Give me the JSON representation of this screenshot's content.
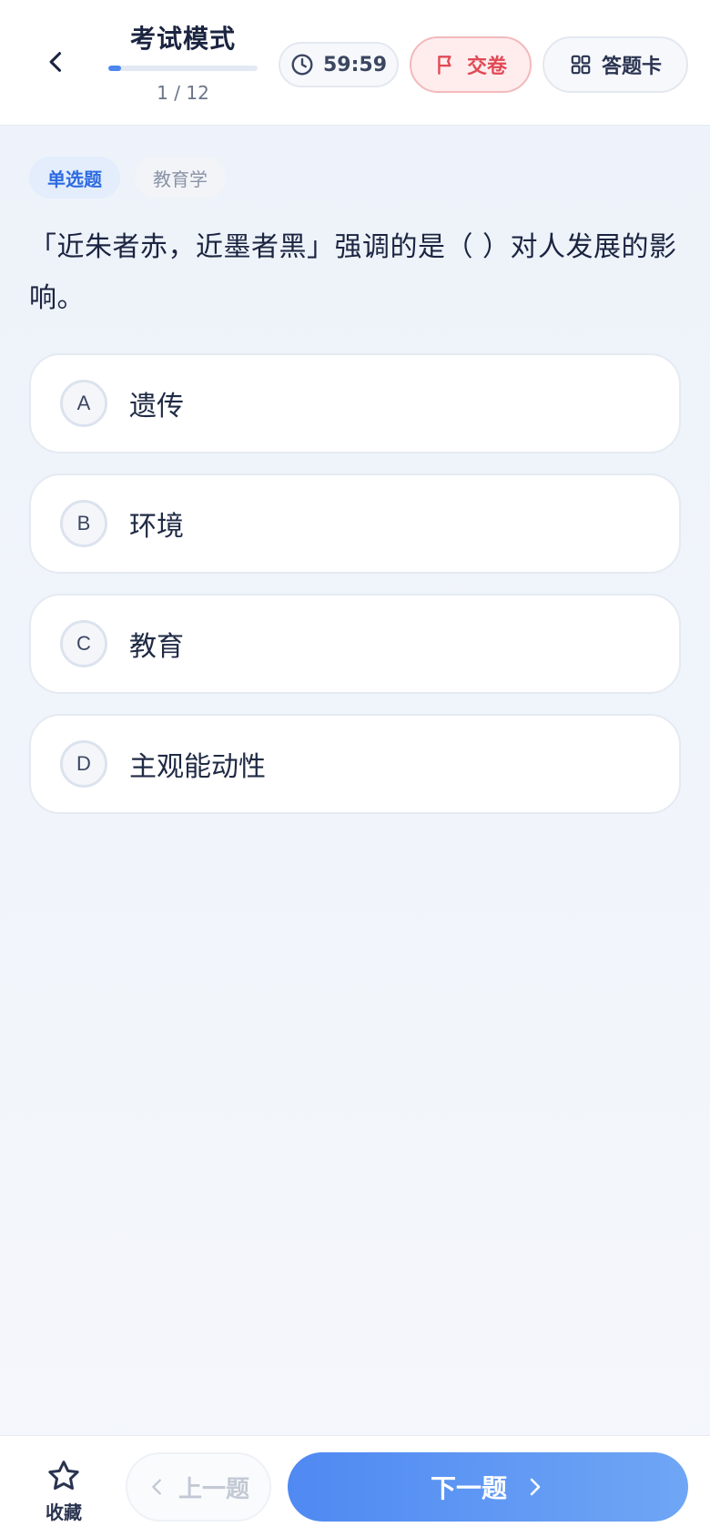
{
  "header": {
    "title": "考试模式",
    "progress_text": "1 / 12",
    "progress_fraction": 0.0833,
    "timer": "59:59",
    "submit_label": "交卷",
    "answer_card_label": "答题卡"
  },
  "question": {
    "type_tag": "单选题",
    "subject_tag": "教育学",
    "text": "「近朱者赤，近墨者黑」强调的是（ ）对人发展的影响。",
    "options": [
      {
        "letter": "A",
        "text": "遗传"
      },
      {
        "letter": "B",
        "text": "环境"
      },
      {
        "letter": "C",
        "text": "教育"
      },
      {
        "letter": "D",
        "text": "主观能动性"
      }
    ]
  },
  "footer": {
    "favorite_label": "收藏",
    "prev_label": "上一题",
    "next_label": "下一题"
  },
  "colors": {
    "accent": "#4C86F0",
    "submit_red": "#E14A55",
    "background": "#EDF2FA"
  },
  "icons": [
    "back-chevron-icon",
    "clock-icon",
    "flag-icon",
    "grid-icon",
    "star-icon",
    "chevron-left-icon",
    "chevron-right-icon"
  ]
}
